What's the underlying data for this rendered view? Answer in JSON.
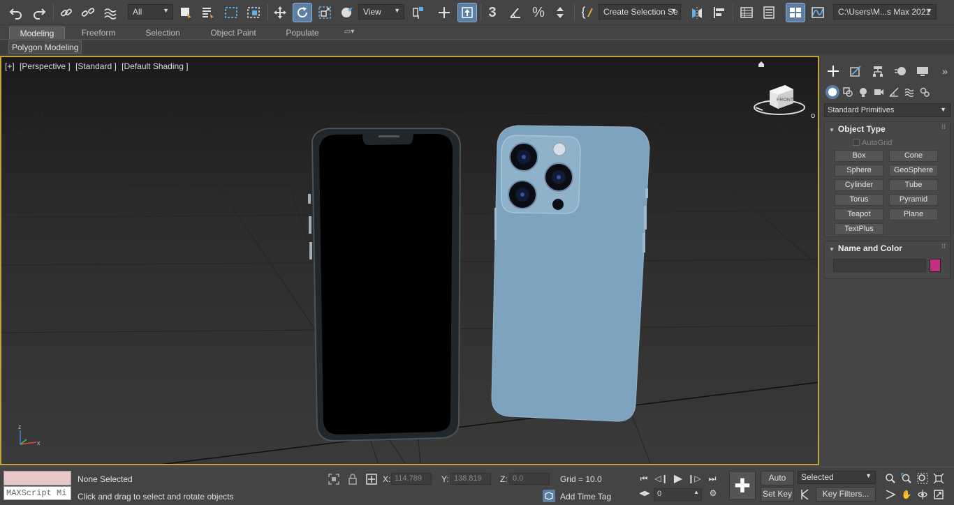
{
  "toolbar": {
    "selection_filter": "All",
    "ref_coord": "View",
    "selection_set": "Create Selection Se",
    "project_path": "C:\\Users\\M...s Max 2021",
    "snap_toggle_3": "3"
  },
  "ribbon": {
    "tabs": [
      "Modeling",
      "Freeform",
      "Selection",
      "Object Paint",
      "Populate"
    ],
    "active_tab": "Modeling",
    "sub_button": "Polygon Modeling"
  },
  "viewport": {
    "labels": [
      "[+]",
      "[Perspective ]",
      "[Standard ]",
      "[Default Shading ]"
    ],
    "viewcube_label": "FRONT",
    "axis_z": "z",
    "axis_x": "x"
  },
  "command_panel": {
    "category": "Standard Primitives",
    "object_type_title": "Object Type",
    "autogrid_label": "AutoGrid",
    "buttons": [
      "Box",
      "Cone",
      "Sphere",
      "GeoSphere",
      "Cylinder",
      "Tube",
      "Torus",
      "Pyramid",
      "Teapot",
      "Plane",
      "TextPlus"
    ],
    "name_color_title": "Name and Color",
    "object_color": "#c2307f"
  },
  "status": {
    "maxscript_placeholder": "MAXScript Mi",
    "selection_status": "None Selected",
    "prompt": "Click and drag to select and rotate objects",
    "x_label": "X:",
    "x_value": "114.789",
    "y_label": "Y:",
    "y_value": "138.819",
    "z_label": "Z:",
    "z_value": "0.0",
    "grid": "Grid = 10.0",
    "add_time_tag": "Add Time Tag",
    "auto_key": "Auto K...",
    "set_key": "Set Key",
    "key_mode": "Selected",
    "key_filters": "Key Filters...",
    "frame": "0"
  }
}
